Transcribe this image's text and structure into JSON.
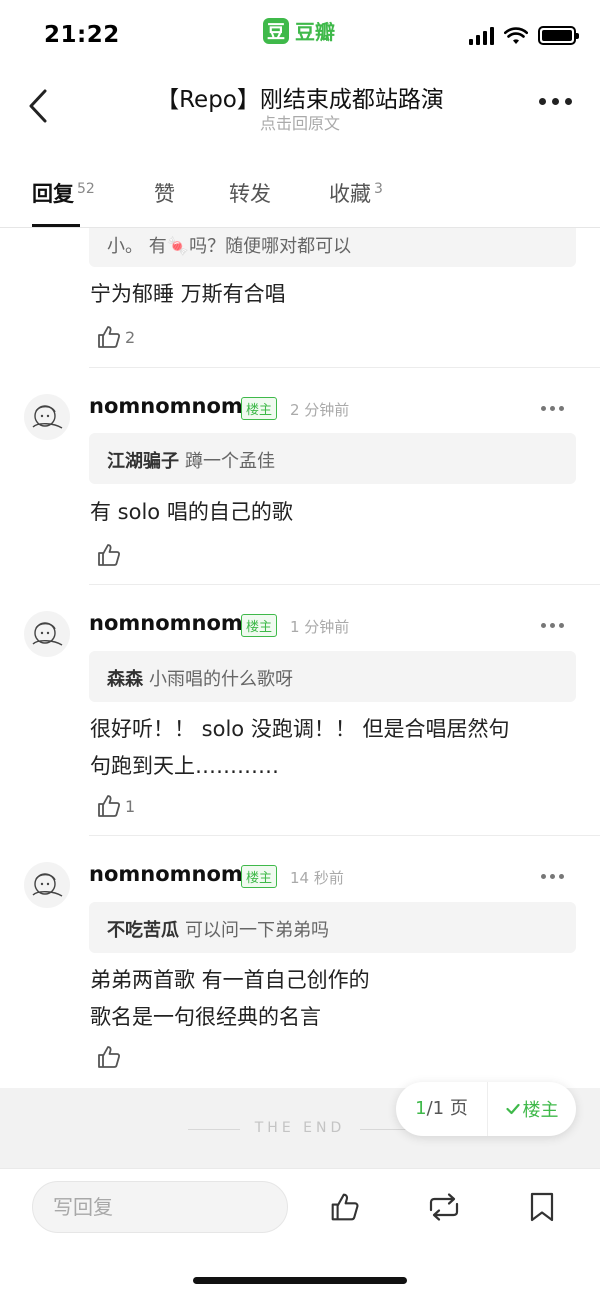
{
  "status_bar": {
    "time": "21:22",
    "app_logo_char": "豆",
    "app_name": "豆瓣"
  },
  "nav": {
    "title": "【Repo】刚结束成都站路演",
    "subtitle": "点击回原文",
    "back_icon": "chevron-left-icon",
    "more_icon": "more-dots-icon"
  },
  "tabs": [
    {
      "label": "回复",
      "count": "52",
      "active": true
    },
    {
      "label": "赞",
      "count": ""
    },
    {
      "label": "转发",
      "count": ""
    },
    {
      "label": "收藏",
      "count": "3"
    }
  ],
  "partial_comment": {
    "quote_text": "小。 有🍬吗？随便哪对都可以",
    "body": "宁为郁睡 万斯有合唱",
    "likes": "2"
  },
  "comments": [
    {
      "username": "nomnomnom",
      "badge": "楼主",
      "time": "2 分钟前",
      "quote_author": "江湖骗子",
      "quote_text": "蹲一个孟佳",
      "body": "有 solo 唱的自己的歌",
      "likes": ""
    },
    {
      "username": "nomnomnom",
      "badge": "楼主",
      "time": "1 分钟前",
      "quote_author": "森森",
      "quote_text": "小雨唱的什么歌呀",
      "body": "很好听！！ solo 没跑调！！ 但是合唱居然句\n句跑到天上…………",
      "likes": "1"
    },
    {
      "username": "nomnomnom",
      "badge": "楼主",
      "time": "14 秒前",
      "quote_author": "不吃苦瓜",
      "quote_text": "可以问一下弟弟吗",
      "body": "弟弟两首歌 有一首自己创作的\n歌名是一句很经典的名言",
      "likes": ""
    }
  ],
  "end_text": "THE END",
  "pager": {
    "current": "1",
    "total": "/1 页",
    "op_label": "楼主"
  },
  "bottom_bar": {
    "reply_placeholder": "写回复",
    "icons": [
      "thumbs-up-icon",
      "repost-icon",
      "bookmark-icon"
    ]
  },
  "colors": {
    "accent": "#3fb94a",
    "text": "#222222",
    "muted": "#aaaaaa"
  }
}
